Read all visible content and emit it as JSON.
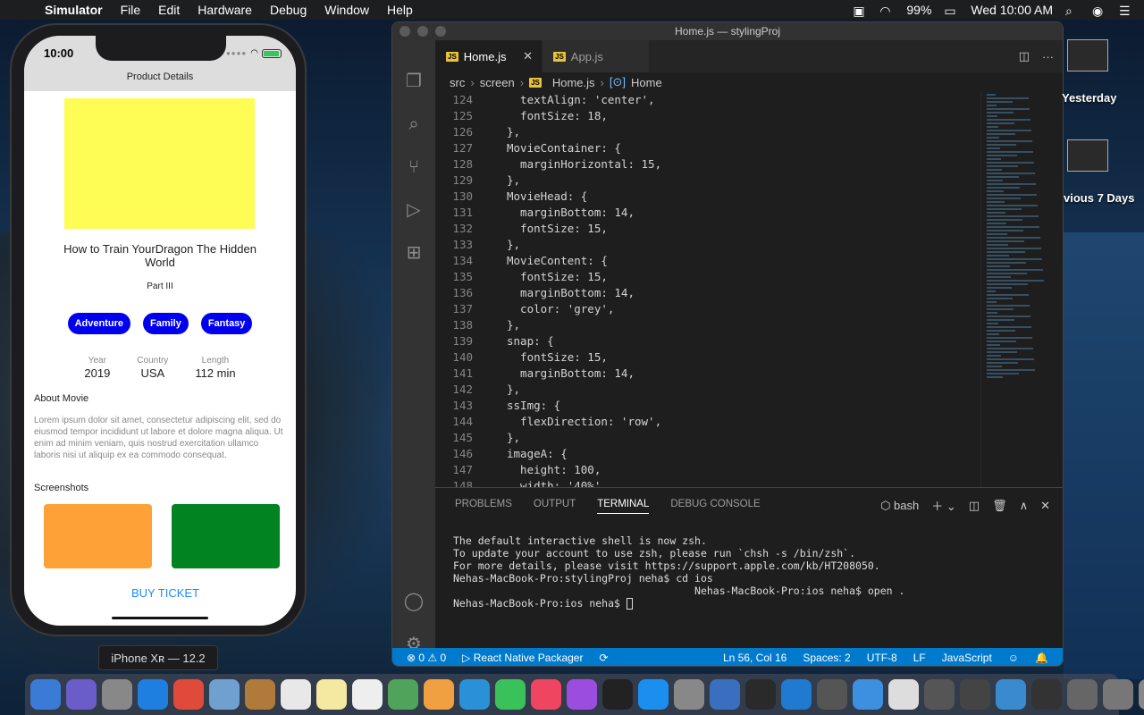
{
  "menubar": {
    "app": "Simulator",
    "items": [
      "File",
      "Edit",
      "Hardware",
      "Debug",
      "Window",
      "Help"
    ],
    "battery": "99%",
    "clock": "Wed 10:00 AM"
  },
  "simulator": {
    "status_time": "10:00",
    "nav_title": "Product Details",
    "movie_title": "How to Train YourDragon The Hidden World",
    "part": "Part III",
    "genres": [
      "Adventure",
      "Family",
      "Fantasy"
    ],
    "stats": [
      {
        "label": "Year",
        "value": "2019"
      },
      {
        "label": "Country",
        "value": "USA"
      },
      {
        "label": "Length",
        "value": "112 min"
      }
    ],
    "about_heading": "About Movie",
    "about_text": "Lorem ipsum dolor sit amet, consectetur adipiscing elit, sed do eiusmod tempor incididunt ut labore et dolore magna aliqua. Ut enim ad minim veniam, quis nostrud exercitation ullamco laboris nisi ut aliquip ex ea commodo consequat.",
    "screenshots_heading": "Screenshots",
    "buy_label": "BUY TICKET",
    "device_label": "iPhone Xʀ — 12.2",
    "colors": {
      "poster": "#fefd55",
      "chip": "#0000ee",
      "shot_a": "#fea237",
      "shot_b": "#028321",
      "buy": "#1a8cff"
    }
  },
  "vscode": {
    "window_title": "Home.js — stylingProj",
    "tabs": [
      {
        "label": "Home.js",
        "active": true
      },
      {
        "label": "App.js",
        "active": false
      }
    ],
    "breadcrumb": [
      "src",
      "screen",
      "Home.js",
      "Home"
    ],
    "code": [
      {
        "n": "124",
        "t": "  textAlign: 'center',"
      },
      {
        "n": "125",
        "t": "  fontSize: 18,"
      },
      {
        "n": "126",
        "t": "},"
      },
      {
        "n": "127",
        "t": "MovieContainer: {"
      },
      {
        "n": "128",
        "t": "  marginHorizontal: 15,"
      },
      {
        "n": "129",
        "t": "},"
      },
      {
        "n": "130",
        "t": "MovieHead: {"
      },
      {
        "n": "131",
        "t": "  marginBottom: 14,"
      },
      {
        "n": "132",
        "t": "  fontSize: 15,"
      },
      {
        "n": "133",
        "t": "},"
      },
      {
        "n": "134",
        "t": "MovieContent: {"
      },
      {
        "n": "135",
        "t": "  fontSize: 15,"
      },
      {
        "n": "136",
        "t": "  marginBottom: 14,"
      },
      {
        "n": "137",
        "t": "  color: 'grey',"
      },
      {
        "n": "138",
        "t": "},"
      },
      {
        "n": "139",
        "t": "snap: {"
      },
      {
        "n": "140",
        "t": "  fontSize: 15,"
      },
      {
        "n": "141",
        "t": "  marginBottom: 14,"
      },
      {
        "n": "142",
        "t": "},"
      },
      {
        "n": "143",
        "t": "ssImg: {"
      },
      {
        "n": "144",
        "t": "  flexDirection: 'row',"
      },
      {
        "n": "145",
        "t": "},"
      },
      {
        "n": "146",
        "t": "imageA: {"
      },
      {
        "n": "147",
        "t": "  height: 100,"
      },
      {
        "n": "148",
        "t": "  width: '40%',"
      }
    ],
    "panel_tabs": [
      "PROBLEMS",
      "OUTPUT",
      "TERMINAL",
      "DEBUG CONSOLE"
    ],
    "active_panel": "TERMINAL",
    "shell": "bash",
    "terminal_lines": [
      "The default interactive shell is now zsh.",
      "To update your account to use zsh, please run `chsh -s /bin/zsh`.",
      "For more details, please visit https://support.apple.com/kb/HT208050.",
      "Nehas-MacBook-Pro:stylingProj neha$ cd ios",
      "                                       Nehas-MacBook-Pro:ios neha$ open .",
      "Nehas-MacBook-Pro:ios neha$ "
    ],
    "status": {
      "problems": "⊗ 0 ⚠ 0",
      "packager": "React Native Packager",
      "position": "Ln 56, Col 16",
      "spaces": "Spaces: 2",
      "encoding": "UTF-8",
      "eol": "LF",
      "language": "JavaScript"
    }
  },
  "desktop": {
    "label_yesterday": "Yesterday",
    "label_prev7": "vious 7 Days"
  },
  "dock_colors": [
    "#3b7bd8",
    "#6a5cc9",
    "#888888",
    "#1e7fe0",
    "#e04a3a",
    "#6fa0d0",
    "#b07a3a",
    "#e8e8e8",
    "#f5e8a0",
    "#eeeeee",
    "#4fa35a",
    "#f0a040",
    "#2a90d8",
    "#39c25a",
    "#f04560",
    "#9b4de0",
    "#222222",
    "#1a8ff0",
    "#888888",
    "#3a6fc0",
    "#2a2a2a",
    "#1f7ad0",
    "#555555",
    "#3d8fe0",
    "#dddddd",
    "#555555",
    "#444444",
    "#3a8ad0",
    "#333333",
    "#666666",
    "#777777",
    "#888888"
  ]
}
